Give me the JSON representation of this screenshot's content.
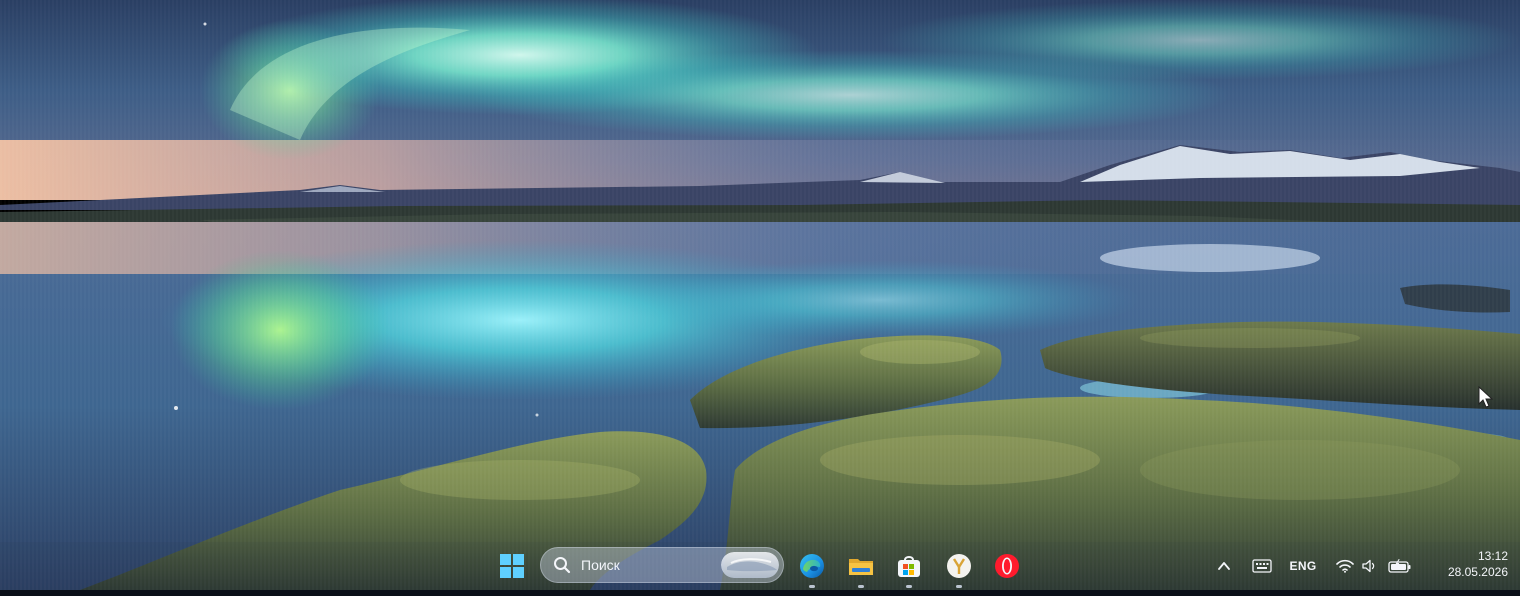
{
  "taskbar": {
    "search": {
      "label": "Поиск"
    },
    "pinned": [
      {
        "name": "start-button",
        "icon": "windows-logo-icon"
      },
      {
        "name": "edge",
        "icon": "edge-icon"
      },
      {
        "name": "file-explorer",
        "icon": "folder-icon"
      },
      {
        "name": "microsoft-store",
        "icon": "store-bag-icon"
      },
      {
        "name": "yandex-browser",
        "icon": "yandex-browser-icon"
      },
      {
        "name": "opera",
        "icon": "opera-icon"
      }
    ]
  },
  "tray": {
    "chevron_icon": "chevron-up-icon",
    "keyboard_icon": "keyboard-icon",
    "language": "ENG",
    "wifi_icon": "wifi-icon",
    "volume_icon": "volume-icon",
    "battery_icon": "battery-icon"
  },
  "clock": {
    "time": "13:12",
    "date": "28.05.2026"
  },
  "colors": {
    "accent_windows": "#4cc2ff",
    "opera_red": "#ff1b2d",
    "edge_blue": "#1a8fe3",
    "folder_yellow": "#f6c343"
  }
}
